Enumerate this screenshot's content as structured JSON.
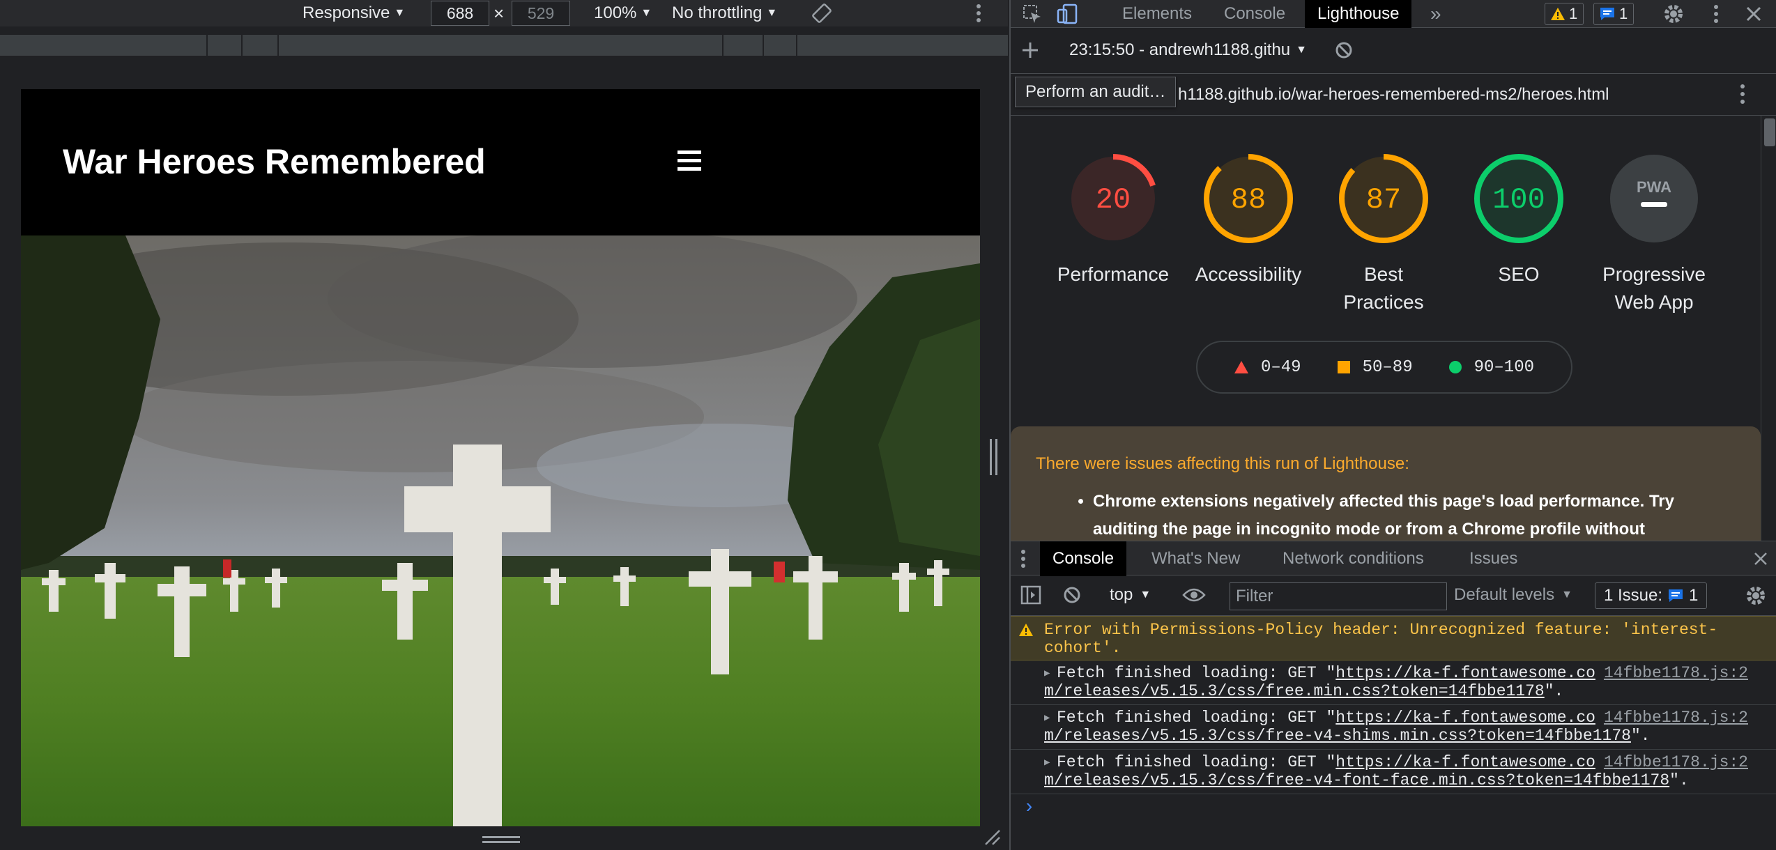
{
  "device_toolbar": {
    "device": "Responsive",
    "width": "688",
    "height": "529",
    "times": "×",
    "zoom": "100%",
    "throttling": "No throttling"
  },
  "site": {
    "title": "War Heroes Remembered"
  },
  "devtools_tabs": {
    "elements": "Elements",
    "console": "Console",
    "lighthouse": "Lighthouse",
    "more": "»",
    "warnings_count": "1",
    "messages_count": "1"
  },
  "lighthouse_toolbar": {
    "report_select": "23:15:50 - andrewh1188.githu",
    "url": "https://andrewh1188.github.io/war-heroes-remembered-ms2/heroes.html",
    "url_visible": "h1188.github.io/war-heroes-remembered-ms2/heroes.html",
    "tooltip": "Perform an audit…"
  },
  "scores": [
    {
      "label": "Performance",
      "value": "20",
      "color": "#ff4e42",
      "fraction": 0.2
    },
    {
      "label": "Accessibility",
      "value": "88",
      "color": "#ffa400",
      "fraction": 0.88
    },
    {
      "label": "Best Practices",
      "label_line1": "Best",
      "label_line2": "Practices",
      "value": "87",
      "color": "#ffa400",
      "fraction": 0.87
    },
    {
      "label": "SEO",
      "value": "100",
      "color": "#0cce6b",
      "fraction": 1.0
    },
    {
      "label": "Progressive Web App",
      "label_line1": "Progressive",
      "label_line2": "Web App",
      "value": "PWA",
      "color": "#9aa0a6"
    }
  ],
  "legend": {
    "fail": "0–49",
    "average": "50–89",
    "pass": "90–100",
    "fail_color": "#ff4e42",
    "average_color": "#ffa400",
    "pass_color": "#0cce6b"
  },
  "issues": {
    "title": "There were issues affecting this run of Lighthouse:",
    "items": [
      "Chrome extensions negatively affected this page's load performance. Try auditing the page in incognito mode or from a Chrome profile without"
    ]
  },
  "drawer": {
    "tabs": [
      "Console",
      "What's New",
      "Network conditions",
      "Issues"
    ]
  },
  "console_toolbar": {
    "context": "top",
    "filter_placeholder": "Filter",
    "levels": "Default levels",
    "issues_label": "1 Issue:",
    "issues_count": "1"
  },
  "console_messages": [
    {
      "type": "warning",
      "text_line1": "Error with Permissions-Policy header: Unrecognized feature: 'interest-",
      "text_line2": "cohort'."
    },
    {
      "type": "info",
      "prefix": "Fetch finished loading: GET \"",
      "link_line1": "https://ka-f.fontawesome.co",
      "link_line2": "m/releases/v5.15.3/css/free.min.css?token=14fbbe1178",
      "suffix": "\".",
      "source": "14fbbe1178.js:2"
    },
    {
      "type": "info",
      "prefix": "Fetch finished loading: GET \"",
      "link_line1": "https://ka-f.fontawesome.co",
      "link_line2": "m/releases/v5.15.3/css/free-v4-shims.min.css?token=14fbbe1178",
      "suffix": "\".",
      "source": "14fbbe1178.js:2"
    },
    {
      "type": "info",
      "prefix": "Fetch finished loading: GET \"",
      "link_line1": "https://ka-f.fontawesome.co",
      "link_line2": "m/releases/v5.15.3/css/free-v4-font-face.min.css?token=14fbbe1178",
      "suffix": "\".",
      "source": "14fbbe1178.js:2"
    }
  ]
}
